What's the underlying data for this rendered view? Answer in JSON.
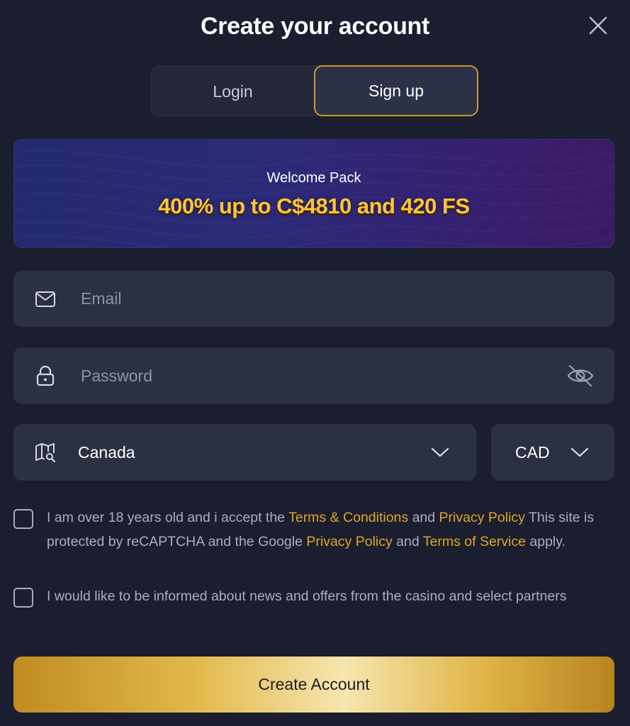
{
  "modal": {
    "title": "Create your account",
    "close_icon": "close-icon"
  },
  "tabs": [
    {
      "label": "Login",
      "active": false
    },
    {
      "label": "Sign up",
      "active": true
    }
  ],
  "banner": {
    "subtitle": "Welcome Pack",
    "offer": "400% up to C$4810 and 420 FS"
  },
  "form": {
    "email": {
      "placeholder": "Email",
      "value": "",
      "icon": "mail-icon"
    },
    "password": {
      "placeholder": "Password",
      "value": "",
      "icon": "lock-icon",
      "toggle_icon": "eye-off-icon"
    },
    "country": {
      "value": "Canada",
      "icon": "map-search-icon"
    },
    "currency": {
      "value": "CAD"
    }
  },
  "consent": {
    "age": {
      "text_1": "I am over 18 years old and i accept the ",
      "terms_link": "Terms & Conditions",
      "text_2": " and ",
      "privacy_link": "Privacy Policy",
      "text_3": " This site is protected by reCAPTCHA and the Google ",
      "google_privacy_link": "Privacy Policy",
      "text_4": " and ",
      "google_terms_link": "Terms of Service",
      "text_5": " apply.",
      "checked": false
    },
    "news": {
      "text": "I would like to be informed about news and offers from the casino and select partners",
      "checked": false
    }
  },
  "submit": {
    "label": "Create Account"
  },
  "colors": {
    "background": "#1b1e2e",
    "field": "#2b3042",
    "accent": "#e0a528",
    "offer_text": "#ffc53a"
  }
}
